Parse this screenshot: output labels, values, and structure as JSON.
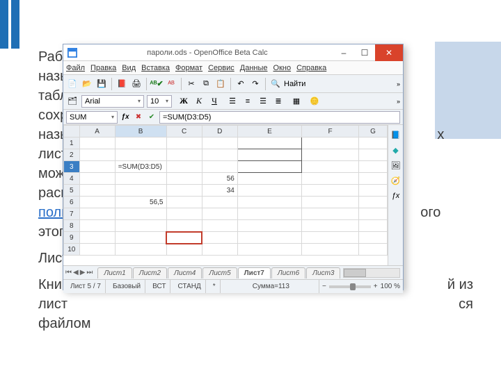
{
  "background": {
    "lines": [
      "Рабо",
      "назы",
      "табл",
      "сохр",
      "назы",
      "лист",
      "можн",
      "расп"
    ],
    "link": "поль",
    "after_link": "этого",
    "para2": "Лист",
    "para3a": "Книга",
    "para3b": "й из",
    "para3c": "лист",
    "para3d": "ся",
    "para3e": "файлом"
  },
  "window": {
    "title": "пароли.ods - OpenOffice Beta Calc",
    "minimize": "–",
    "maximize": "☐",
    "close": "✕"
  },
  "menu": {
    "file": "Файл",
    "edit": "Правка",
    "view": "Вид",
    "insert": "Вставка",
    "format": "Формат",
    "tools": "Сервис",
    "data": "Данные",
    "window": "Окно",
    "help": "Справка"
  },
  "toolbar": {
    "find_label": "Найти"
  },
  "format_bar": {
    "font": "Arial",
    "size": "10",
    "bold": "Ж",
    "italic": "К",
    "underline": "Ч"
  },
  "formula_row": {
    "namebox": "SUM",
    "formula": "=SUM(D3:D5)"
  },
  "columns": [
    "A",
    "B",
    "C",
    "D",
    "E",
    "F",
    "G"
  ],
  "rows": [
    {
      "n": "1"
    },
    {
      "n": "2"
    },
    {
      "n": "3",
      "B": "=SUM(D3:D5)"
    },
    {
      "n": "4",
      "D": "56"
    },
    {
      "n": "5",
      "D": "34"
    },
    {
      "n": "6",
      "B": "56,5"
    },
    {
      "n": "7"
    },
    {
      "n": "8"
    },
    {
      "n": "9"
    },
    {
      "n": "10"
    }
  ],
  "sheet_tabs": [
    "Лист1",
    "Лист2",
    "Лист4",
    "Лист5",
    "Лист7",
    "Лист6",
    "Лист3"
  ],
  "active_tab": "Лист7",
  "status": {
    "sheet": "Лист 5 / 7",
    "style": "Базовый",
    "ins": "ВСТ",
    "mode": "СТАНД",
    "mod": "*",
    "sum": "Сумма=113",
    "zoom_minus": "−",
    "zoom_plus": "+",
    "zoom_pct": "100 %"
  }
}
